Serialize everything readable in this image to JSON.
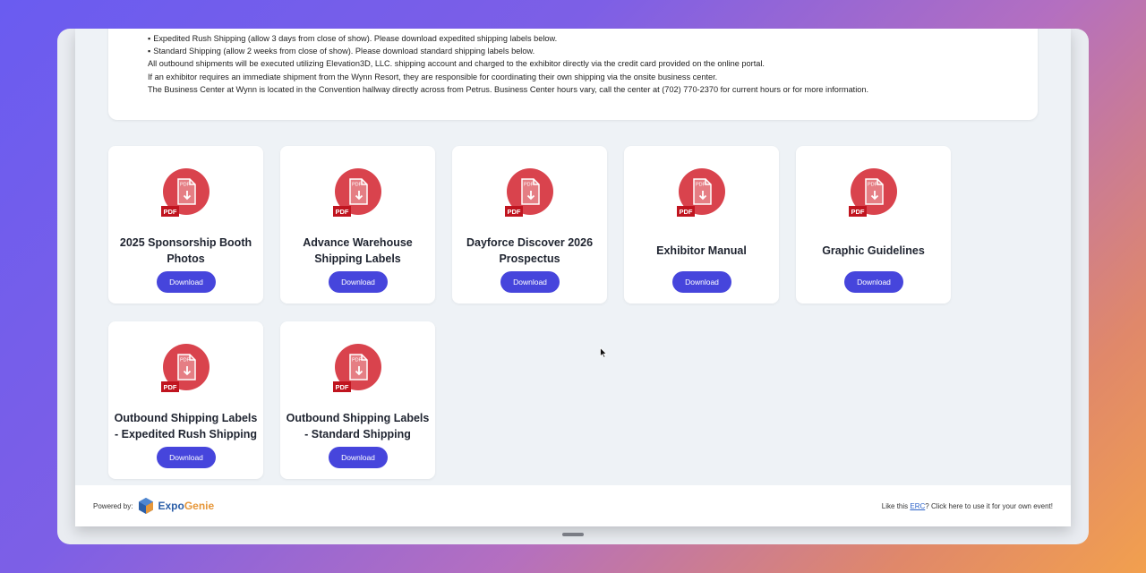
{
  "notice": {
    "lines": [
      "Expedited Rush Shipping (allow 3 days from close of show).  Please download expedited shipping labels below.",
      "Standard Shipping (allow 2 weeks from close of show). Please download standard shipping labels below.",
      "All outbound shipments will be executed utilizing Elevation3D, LLC. shipping account and charged to the exhibitor directly via the credit card provided on the online portal.",
      "If an exhibitor requires an immediate shipment from the Wynn Resort, they are responsible for coordinating their own shipping via the onsite business center.",
      "The Business Center at Wynn is located in the Convention hallway directly across from Petrus. Business Center hours vary, call the center at (702) 770-2370 for current hours or for more information."
    ]
  },
  "documents": [
    {
      "title": "2025 Sponsorship Booth Photos",
      "badge": "PDF",
      "button": "Download"
    },
    {
      "title": "Advance Warehouse Shipping Labels",
      "badge": "PDF",
      "button": "Download"
    },
    {
      "title": "Dayforce Discover 2026 Prospectus",
      "badge": "PDF",
      "button": "Download"
    },
    {
      "title": "Exhibitor Manual",
      "badge": "PDF",
      "button": "Download"
    },
    {
      "title": "Graphic Guidelines",
      "badge": "PDF",
      "button": "Download"
    },
    {
      "title": "Outbound Shipping Labels - Expedited Rush Shipping",
      "badge": "PDF",
      "button": "Download"
    },
    {
      "title": "Outbound Shipping Labels - Standard Shipping",
      "badge": "PDF",
      "button": "Download"
    }
  ],
  "icons": {
    "document": "pdf-download-icon",
    "cursor": "mouse-pointer-icon",
    "logo": "expogenie-logo-icon"
  },
  "footer": {
    "powered_by": "Powered by:",
    "logo_expo": "Expo",
    "logo_genie": "Genie",
    "cta_prefix": "Like this ",
    "cta_link": "ERC",
    "cta_suffix": "? Click here to use it for your own event!"
  },
  "colors": {
    "accent": "#4645dc",
    "pdf_red": "#d9434d",
    "logo_blue": "#2c5fa8",
    "logo_orange": "#e6973a"
  }
}
